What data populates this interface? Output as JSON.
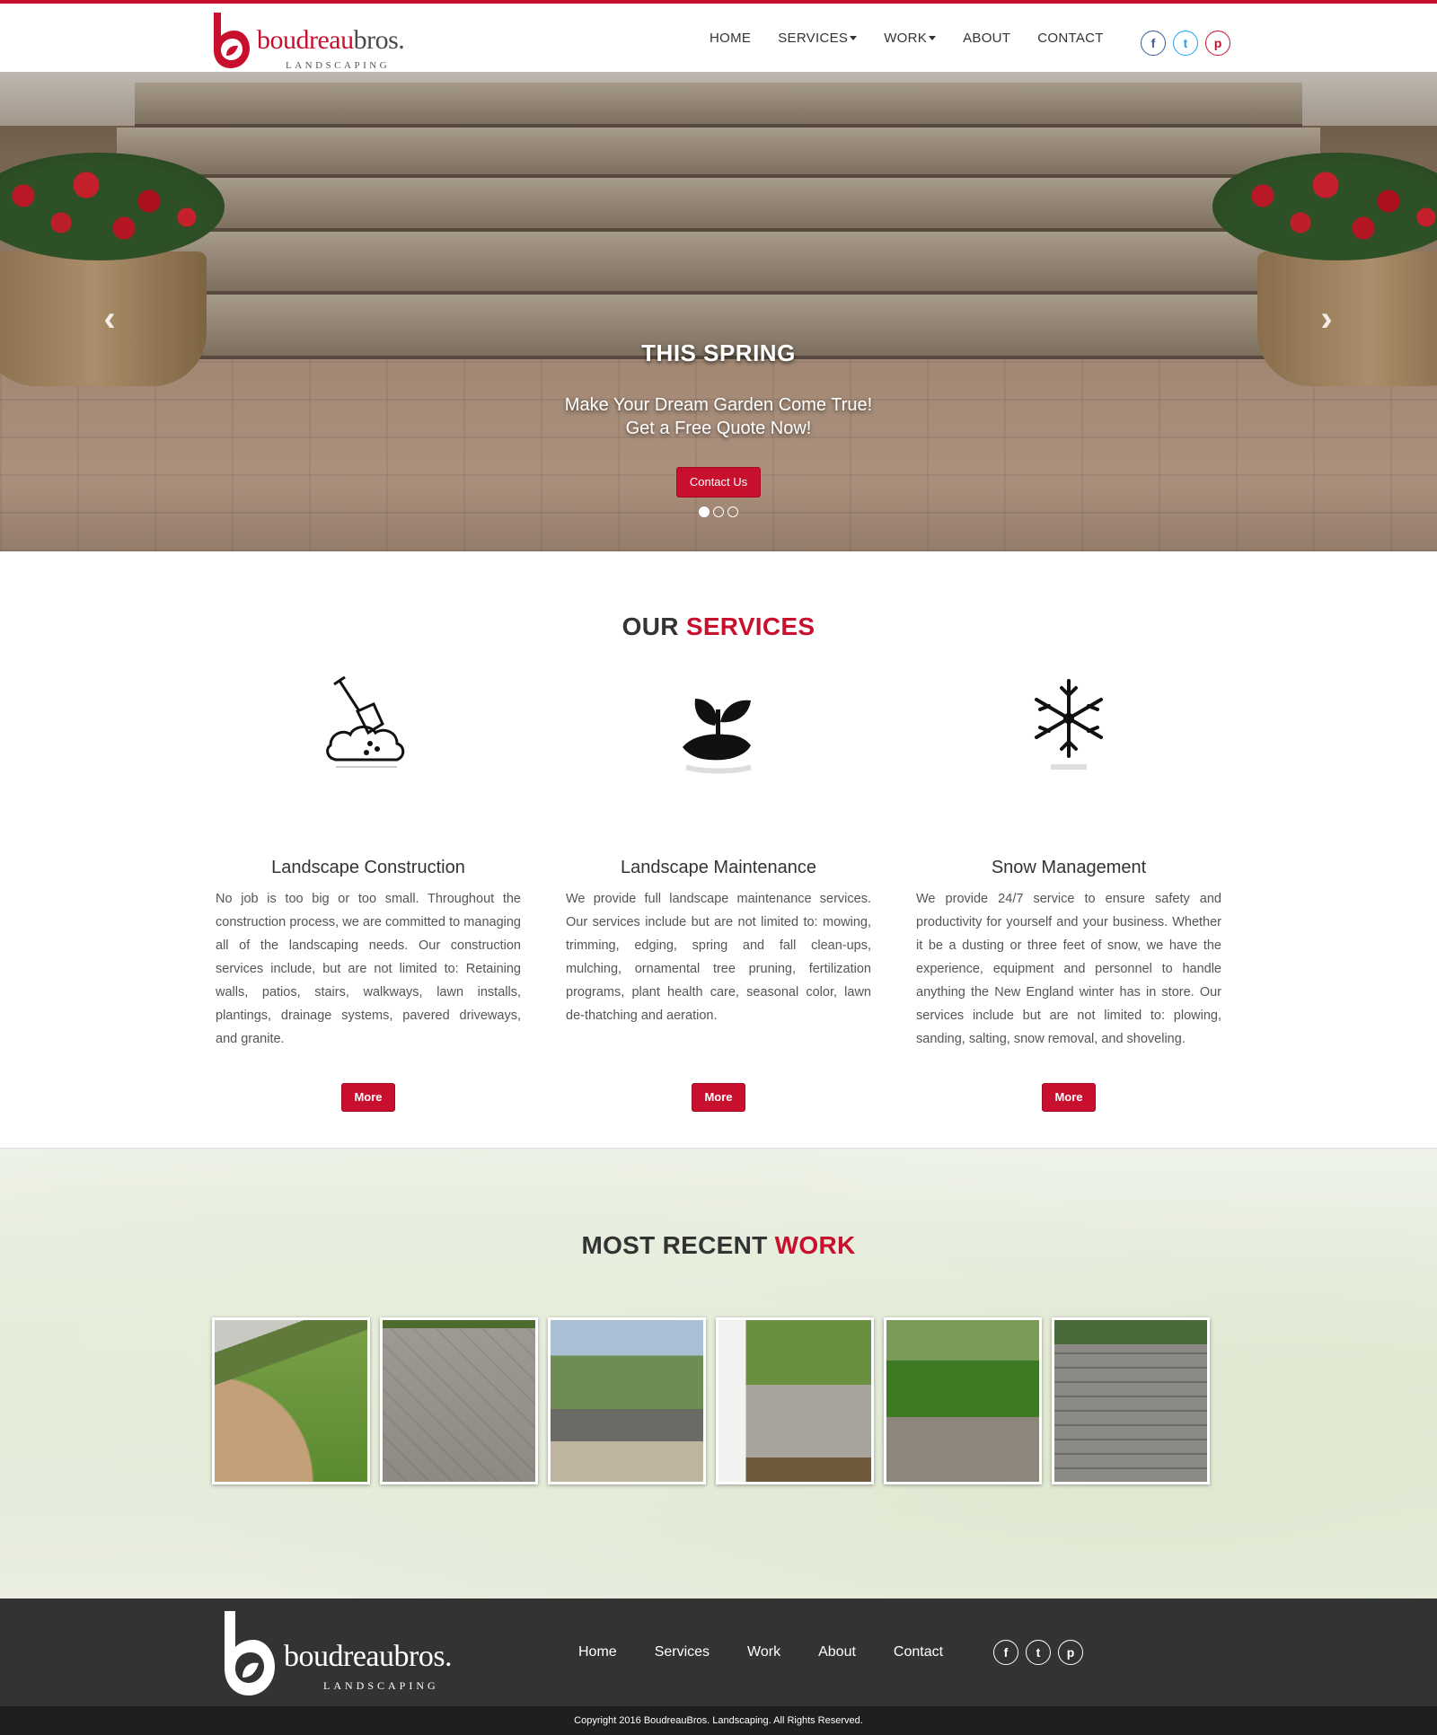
{
  "header": {
    "logo": {
      "name": "boudreau",
      "name_accent": "bros.",
      "sub": "LANDSCAPING"
    },
    "nav": [
      {
        "label": "HOME"
      },
      {
        "label": "SERVICES",
        "dropdown": true
      },
      {
        "label": "WORK",
        "dropdown": true
      },
      {
        "label": "ABOUT"
      },
      {
        "label": "CONTACT"
      }
    ],
    "social": [
      {
        "icon": "facebook-icon",
        "glyph": "f"
      },
      {
        "icon": "twitter-icon",
        "glyph": "t"
      },
      {
        "icon": "pinterest-icon",
        "glyph": "p"
      }
    ]
  },
  "hero": {
    "title": "THIS SPRING",
    "subtitle_line1": "Make Your Dream Garden Come True!",
    "subtitle_line2": "Get a Free Quote Now!",
    "button_label": "Contact Us",
    "prev_glyph": "‹",
    "next_glyph": "›",
    "slide_count": 3,
    "active_slide": 1
  },
  "services": {
    "title_plain": "OUR",
    "title_accent": "SERVICES",
    "items": [
      {
        "icon": "shovel-icon",
        "title": "Landscape Construction",
        "description": "No job is too big or too small. Throughout the construction process, we are committed to managing all of the landscaping needs. Our construction services include, but are not limited to: Retaining walls, patios, stairs, walkways, lawn installs, plantings, drainage systems, pavered driveways, and granite.",
        "button_label": "More"
      },
      {
        "icon": "plant-in-hand-icon",
        "title": "Landscape Maintenance",
        "description": "We provide full landscape maintenance services. Our services include but are not limited to: mowing, trimming, edging, spring and fall clean-ups, mulching, ornamental tree pruning, fertilization programs, plant health care, seasonal color, lawn de-thatching and aeration.",
        "button_label": "More"
      },
      {
        "icon": "snowflake-icon",
        "title": "Snow Management",
        "description": "We provide 24/7 service to ensure safety and productivity for yourself and your business. Whether it be a dusting or three feet of snow, we have the experience, equipment and personnel to handle anything the New England winter has in store. Our services include but are not limited to: plowing, sanding, salting, snow removal, and shoveling.",
        "button_label": "More"
      }
    ]
  },
  "work": {
    "title_plain": "MOST RECENT",
    "title_accent": "WORK",
    "thumbnail_count": 6
  },
  "footer": {
    "logo": {
      "name": "boudreaubros.",
      "sub": "LANDSCAPING"
    },
    "nav": [
      {
        "label": "Home"
      },
      {
        "label": "Services"
      },
      {
        "label": "Work"
      },
      {
        "label": "About"
      },
      {
        "label": "Contact"
      }
    ],
    "social": [
      {
        "icon": "facebook-icon",
        "glyph": "f"
      },
      {
        "icon": "twitter-icon",
        "glyph": "t"
      },
      {
        "icon": "pinterest-icon",
        "glyph": "p"
      }
    ],
    "copyright": "Copyright 2016 BoudreauBros. Landscaping. All Rights Reserved."
  },
  "colors": {
    "accent": "#c8102e",
    "footer_bg": "#333333",
    "copyright_bg": "#1f1f1f"
  }
}
